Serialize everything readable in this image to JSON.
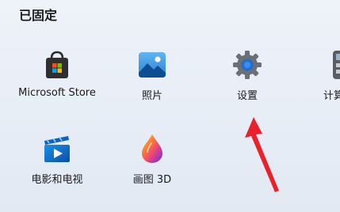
{
  "pinned": {
    "title": "已固定",
    "apps": [
      {
        "label": "Microsoft Store",
        "icon": "microsoft-store-icon"
      },
      {
        "label": "照片",
        "icon": "photos-icon"
      },
      {
        "label": "设置",
        "icon": "gear-icon"
      },
      {
        "label": "计算",
        "icon": "calculator-icon"
      },
      {
        "label": "电影和电视",
        "icon": "movies-tv-icon"
      },
      {
        "label": "画图 3D",
        "icon": "paint-3d-icon"
      }
    ]
  },
  "annotation": {
    "icon": "annotation-arrow-icon",
    "color": "#e8212a",
    "target": "设置"
  },
  "colors": {
    "background": "#e9eef6",
    "accent": "#1e6fd1"
  }
}
